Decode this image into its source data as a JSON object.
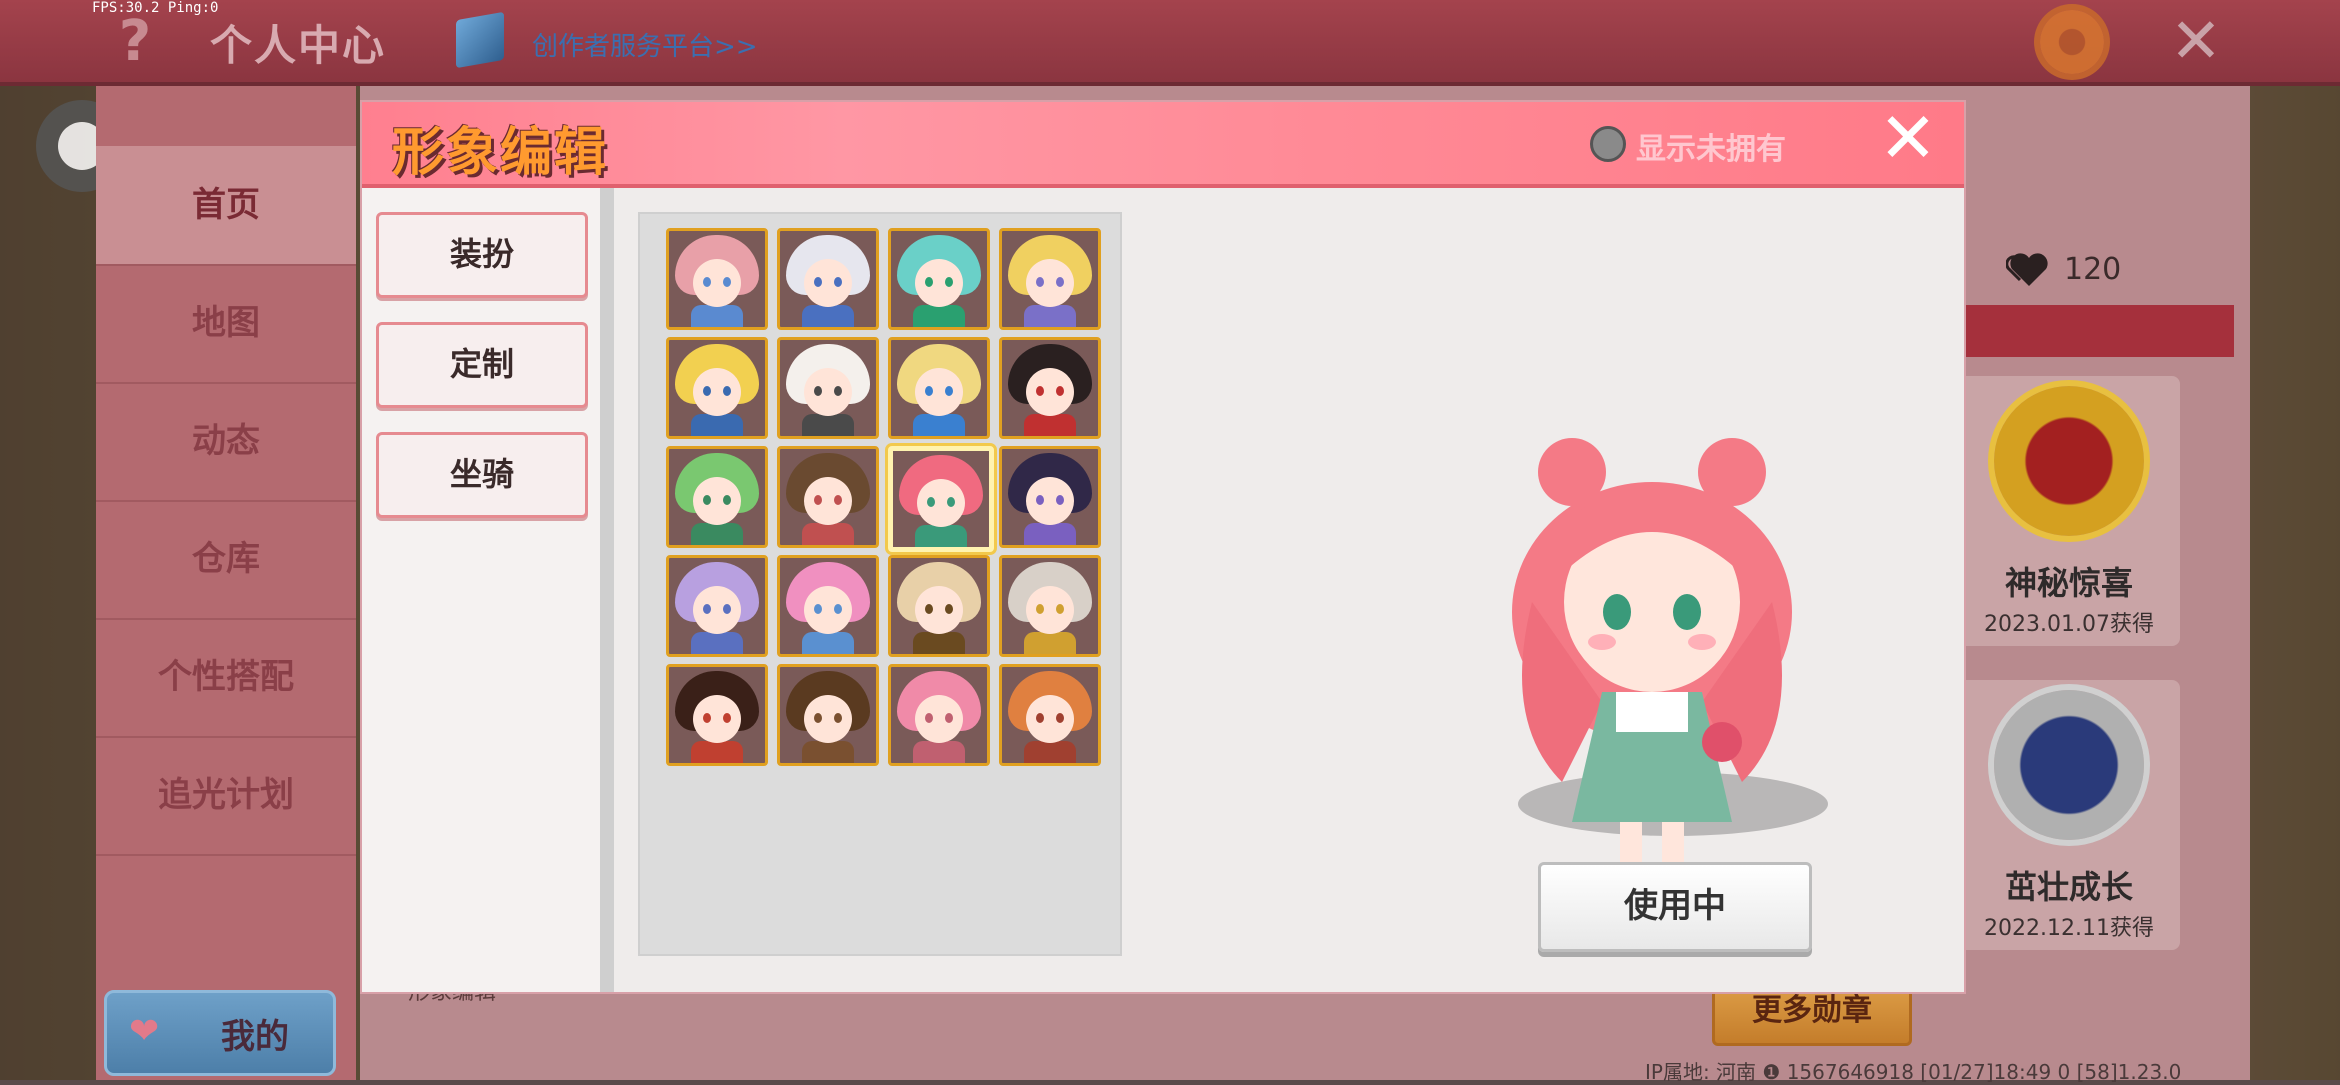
{
  "status": {
    "fps_text": "FPS:30.2  Ping:0"
  },
  "topbar": {
    "title": "个人中心",
    "creator_link": "创作者服务平台>>"
  },
  "sidebar": {
    "items": [
      {
        "label": "首页",
        "active": true
      },
      {
        "label": "地图"
      },
      {
        "label": "动态"
      },
      {
        "label": "仓库"
      },
      {
        "label": "个性搭配"
      },
      {
        "label": "追光计划"
      }
    ],
    "mine_label": "我的"
  },
  "background_panel": {
    "likes": "120",
    "behind_label": "形象编辑",
    "medals": [
      {
        "name": "神秘惊喜",
        "date": "2023.01.07获得"
      },
      {
        "name": "茁壮成长",
        "date": "2022.12.11获得"
      }
    ],
    "more_medals": "更多勋章",
    "footer": "IP属地: 河南 ❶    1567646918    [01/27]18:49 0  [58]1.23.0"
  },
  "modal": {
    "title": "形象编辑",
    "show_unowned": "显示未拥有",
    "tabs": [
      "装扮",
      "定制",
      "坐骑"
    ],
    "selected_avatar_index": 10,
    "in_use_label": "使用中"
  },
  "colors": {
    "accent_pink": "#ff8a96",
    "title_orange": "#ff9a2f",
    "tab_border": "#e68a90",
    "avatar_border": "#e0a020"
  },
  "icons": {
    "help": "question-mark",
    "creator": "cube",
    "settings": "gear",
    "close": "x",
    "likes": "heart",
    "radio": "circle"
  }
}
